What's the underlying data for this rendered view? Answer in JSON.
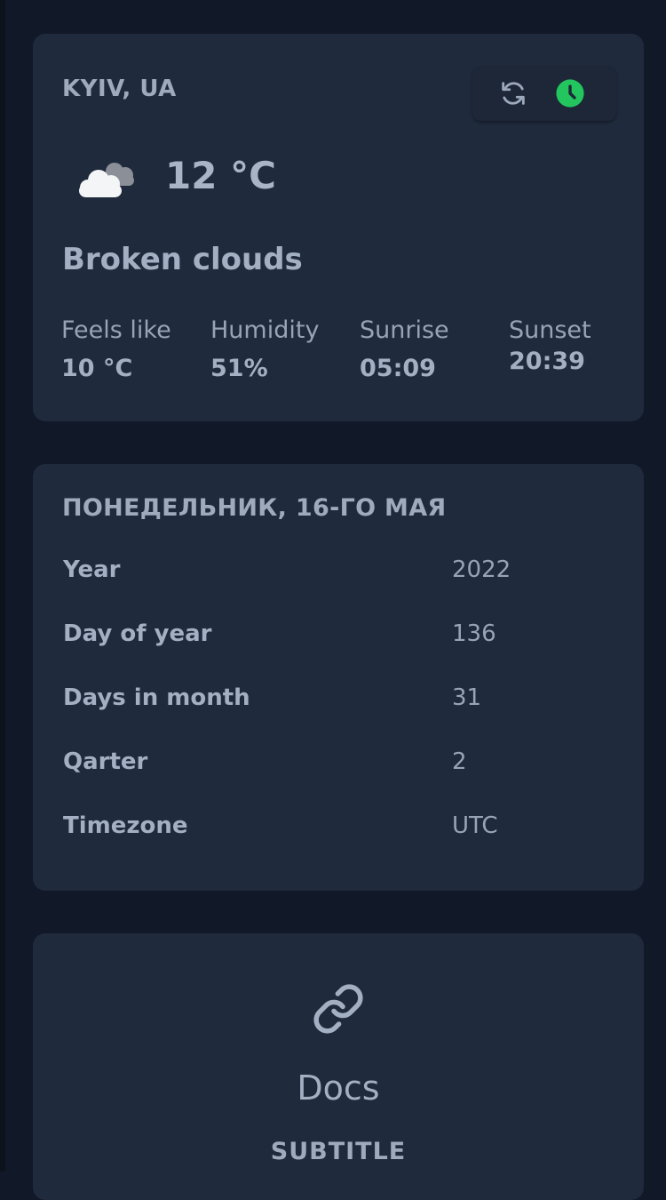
{
  "weather": {
    "city": "KYIV, UA",
    "temperature": "12 °C",
    "description": "Broken clouds",
    "icon": "broken-clouds-icon",
    "stats": {
      "feels_like": {
        "label": "Feels like",
        "value": "10 °C"
      },
      "humidity": {
        "label": "Humidity",
        "value": "51%"
      },
      "sunrise": {
        "label": "Sunrise",
        "value": "05:09"
      },
      "sunset": {
        "label": "Sunset",
        "value": "20:39"
      }
    },
    "buttons": {
      "refresh_icon": "refresh-icon",
      "clock_icon": "clock-icon",
      "clock_color": "#22c55e"
    }
  },
  "date_info": {
    "heading": "ПОНЕДЕЛЬНИК, 16-ГО МАЯ",
    "rows": [
      {
        "label": "Year",
        "value": "2022"
      },
      {
        "label": "Day of year",
        "value": "136"
      },
      {
        "label": "Days in month",
        "value": "31"
      },
      {
        "label": "Qarter",
        "value": "2"
      },
      {
        "label": "Timezone",
        "value": "UTC"
      }
    ]
  },
  "docs": {
    "icon": "link-icon",
    "title": "Docs",
    "subtitle": "SUBTITLE"
  },
  "colors": {
    "background": "#111827",
    "card": "#1f2a3c",
    "text": "#9ca9bc",
    "accent_green": "#22c55e"
  }
}
